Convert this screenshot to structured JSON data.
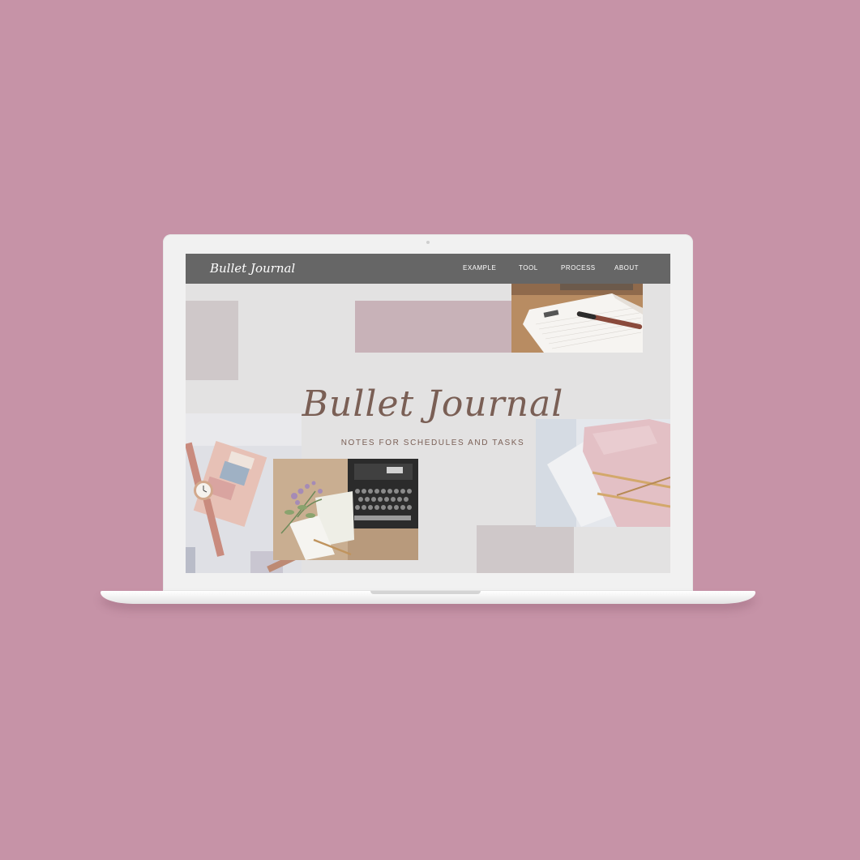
{
  "brand": "Bullet Journal",
  "nav": {
    "items": [
      {
        "label": "EXAMPLE"
      },
      {
        "label": "TOOL"
      },
      {
        "label": "PROCESS"
      },
      {
        "label": "ABOUT"
      }
    ]
  },
  "hero": {
    "title": "Bullet Journal",
    "subtitle": "NOTES FOR SCHEDULES AND TASKS"
  },
  "colors": {
    "background": "#c693a7",
    "screen": "#e3e2e2",
    "navbar": "#666666",
    "block_pink": "#c8b2b8",
    "block_gray": "#cfc8c9",
    "title_text": "#7a5f55"
  }
}
